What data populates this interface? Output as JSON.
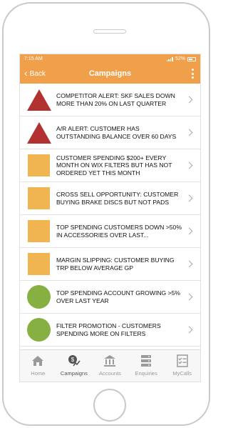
{
  "status": {
    "time": "7:15 AM",
    "battery": "52%"
  },
  "nav": {
    "back_label": "Back",
    "title": "Campaigns"
  },
  "campaigns": [
    {
      "icon": "triangle-red",
      "text": "COMPETITOR ALERT: SKF SALES DOWN MORE THAN 20% ON LAST QUARTER"
    },
    {
      "icon": "triangle-red",
      "text": "A/R ALERT: CUSTOMER HAS OUTSTANDING BALANCE OVER 60 DAYS"
    },
    {
      "icon": "square-orange",
      "text": "CUSTOMER SPENDING $200+ EVERY MONTH ON WIX FILTERS BUT HAS NOT ORDERED YET THIS MONTH"
    },
    {
      "icon": "square-orange",
      "text": "CROSS SELL OPPORTUNITY: CUSTOMER BUYING BRAKE DISCS BUT NOT PADS"
    },
    {
      "icon": "square-orange",
      "text": "TOP SPENDING CUSTOMERS DOWN >50% IN ACCESSORIES OVER LAST..."
    },
    {
      "icon": "square-orange",
      "text": "MARGIN SLIPPING: CUSTOMER BUYING TRP BELOW AVERAGE GP"
    },
    {
      "icon": "circle-green",
      "text": "TOP SPENDING ACCOUNT GROWING >5% OVER LAST YEAR"
    },
    {
      "icon": "circle-green",
      "text": "FILTER PROMOTION - CUSTOMERS SPENDING MORE ON FILTERS"
    }
  ],
  "tabs": [
    {
      "label": "Home",
      "icon": "home-icon"
    },
    {
      "label": "Campaigns",
      "icon": "campaigns-icon",
      "active": true
    },
    {
      "label": "Accounts",
      "icon": "bank-icon"
    },
    {
      "label": "Enquiries",
      "icon": "server-icon"
    },
    {
      "label": "MyCalls",
      "icon": "checklist-icon"
    }
  ],
  "colors": {
    "accent": "#f0a04a",
    "alert_red": "#b23232",
    "warning_orange": "#f0b550",
    "positive_green": "#86b041"
  }
}
